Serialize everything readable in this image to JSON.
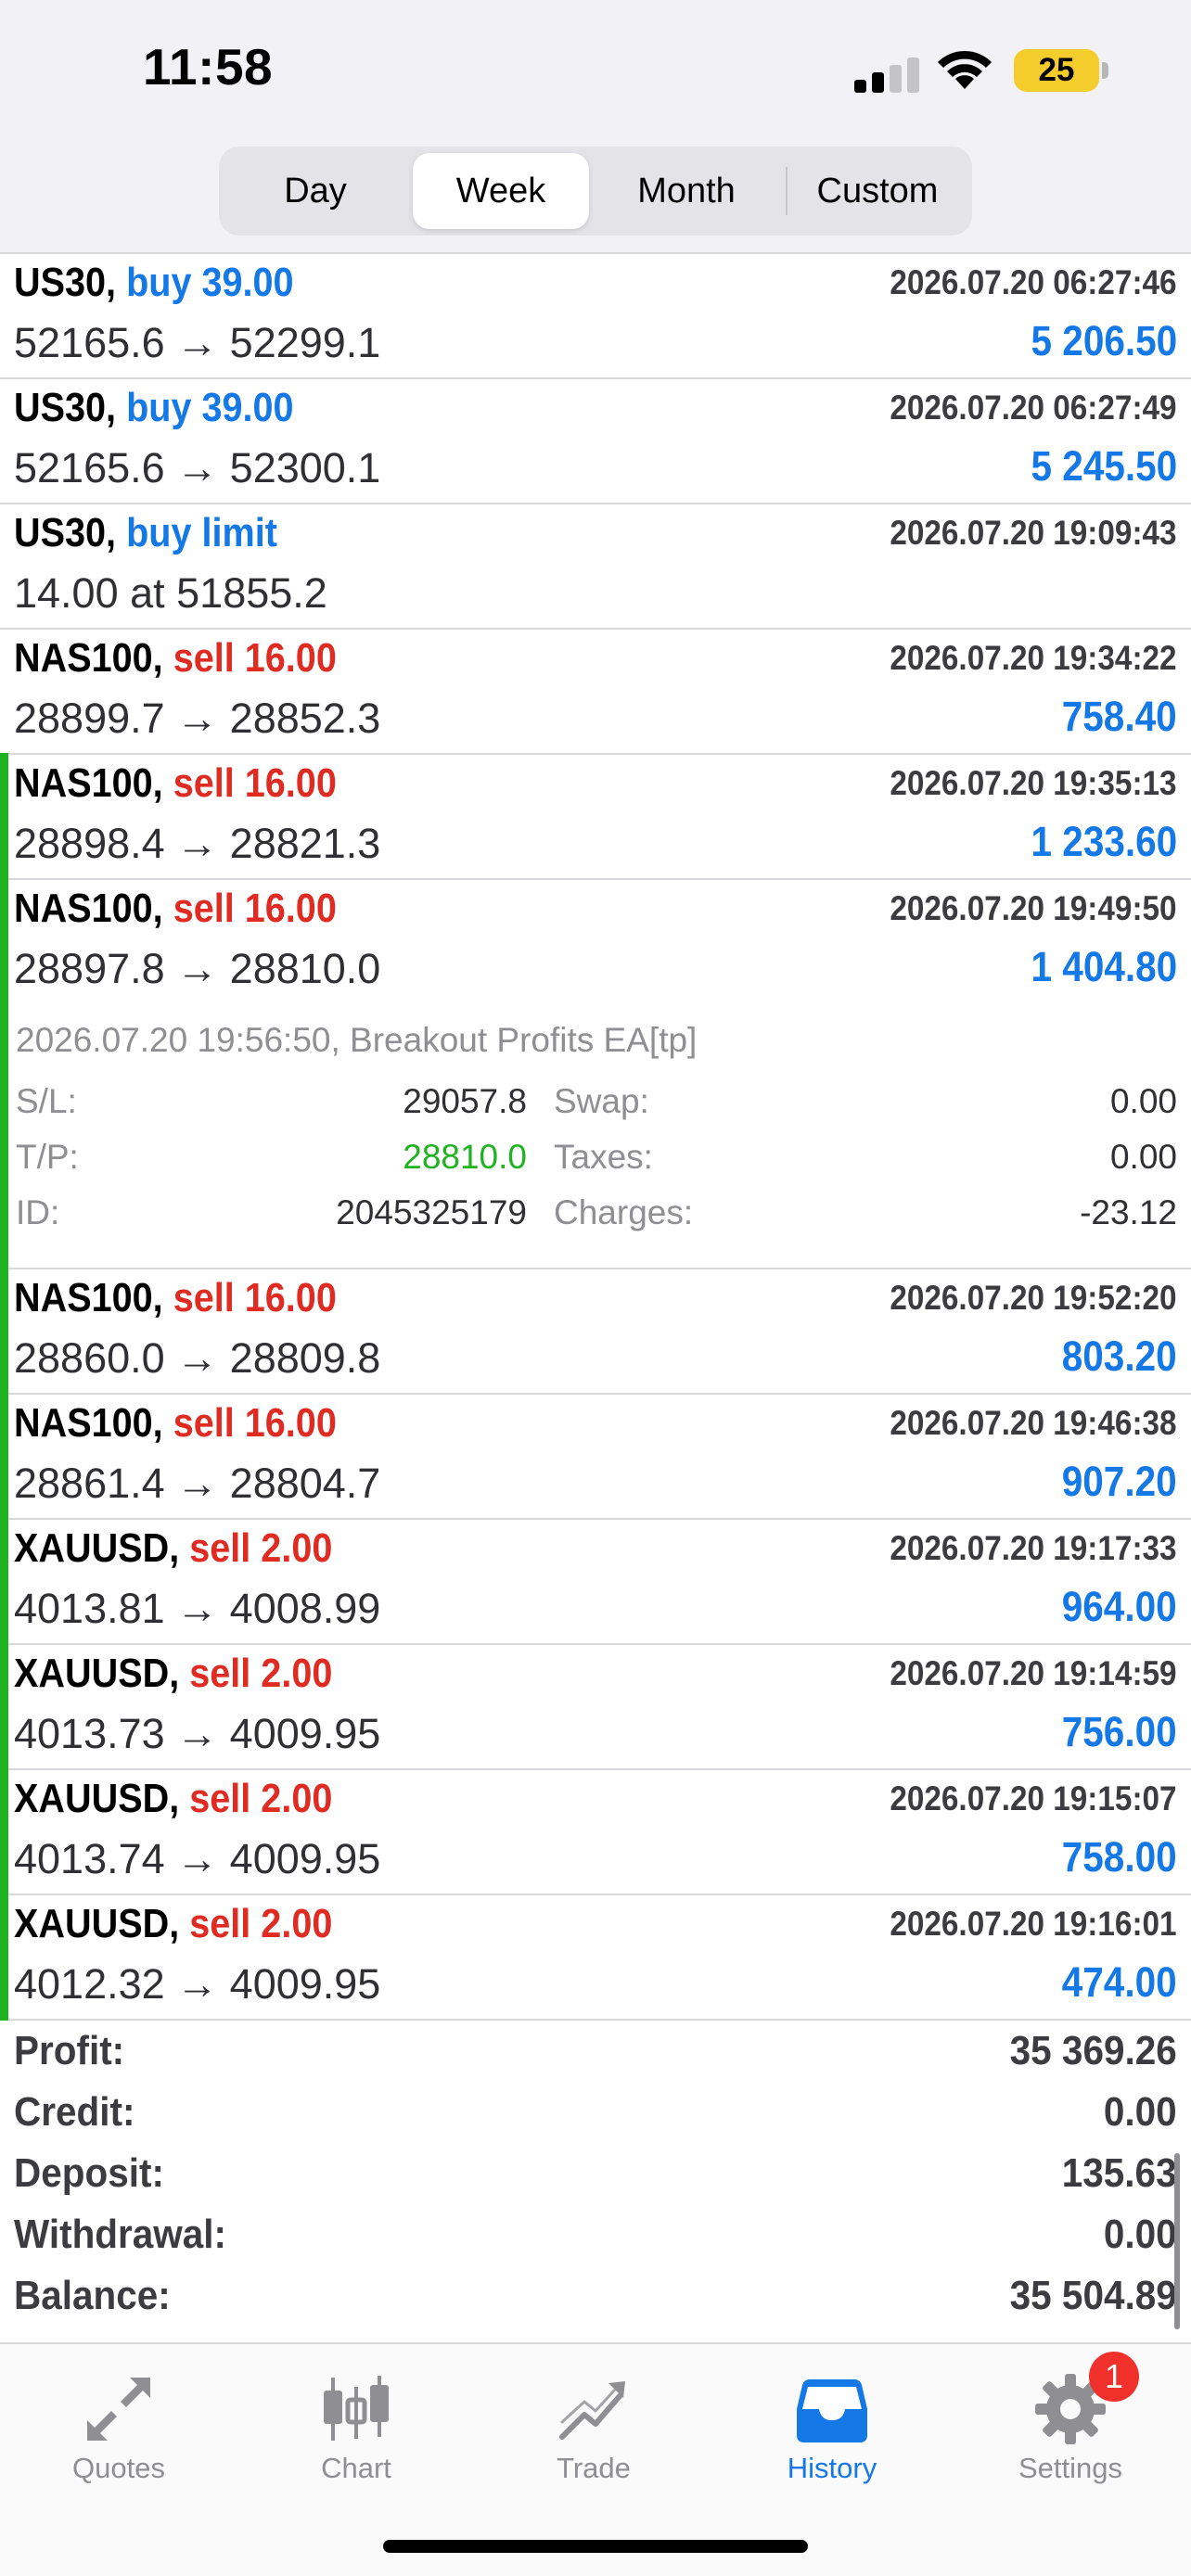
{
  "status_bar": {
    "time": "11:58",
    "battery": "25"
  },
  "period_tabs": [
    {
      "label": "Day",
      "active": false
    },
    {
      "label": "Week",
      "active": true
    },
    {
      "label": "Month",
      "active": false
    },
    {
      "label": "Custom",
      "active": false
    }
  ],
  "deals": [
    {
      "symbol": "US30,",
      "action": "buy 39.00",
      "action_color": "blue",
      "datetime": "2026.07.20 06:27:46",
      "prices": "52165.6 → 52299.1",
      "profit": "5 206.50"
    },
    {
      "symbol": "US30,",
      "action": "buy 39.00",
      "action_color": "blue",
      "datetime": "2026.07.20 06:27:49",
      "prices": "52165.6 → 52300.1",
      "profit": "5 245.50"
    },
    {
      "symbol": "US30,",
      "action": "buy limit",
      "action_color": "blue",
      "datetime": "2026.07.20 19:09:43",
      "prices": "14.00 at 51855.2",
      "profit": ""
    },
    {
      "symbol": "NAS100,",
      "action": "sell 16.00",
      "action_color": "red",
      "datetime": "2026.07.20 19:34:22",
      "prices": "28899.7 → 28852.3",
      "profit": "758.40"
    },
    {
      "symbol": "NAS100,",
      "action": "sell 16.00",
      "action_color": "red",
      "datetime": "2026.07.20 19:35:13",
      "prices": "28898.4 → 28821.3",
      "profit": "1 233.60"
    },
    {
      "symbol": "NAS100,",
      "action": "sell 16.00",
      "action_color": "red",
      "datetime": "2026.07.20 19:49:50",
      "prices": "28897.8 → 28810.0",
      "profit": "1 404.80",
      "details": {
        "comment": "2026.07.20 19:56:50, Breakout Profits EA[tp]",
        "sl_label": "S/L:",
        "sl_value": "29057.8",
        "tp_label": "T/P:",
        "tp_value": "28810.0",
        "id_label": "ID:",
        "id_value": "2045325179",
        "swap_label": "Swap:",
        "swap_value": "0.00",
        "taxes_label": "Taxes:",
        "taxes_value": "0.00",
        "charges_label": "Charges:",
        "charges_value": "-23.12"
      }
    },
    {
      "symbol": "NAS100,",
      "action": "sell 16.00",
      "action_color": "red",
      "datetime": "2026.07.20 19:52:20",
      "prices": "28860.0 → 28809.8",
      "profit": "803.20"
    },
    {
      "symbol": "NAS100,",
      "action": "sell 16.00",
      "action_color": "red",
      "datetime": "2026.07.20 19:46:38",
      "prices": "28861.4 → 28804.7",
      "profit": "907.20"
    },
    {
      "symbol": "XAUUSD,",
      "action": "sell 2.00",
      "action_color": "red",
      "datetime": "2026.07.20 19:17:33",
      "prices": "4013.81 → 4008.99",
      "profit": "964.00"
    },
    {
      "symbol": "XAUUSD,",
      "action": "sell 2.00",
      "action_color": "red",
      "datetime": "2026.07.20 19:14:59",
      "prices": "4013.73 → 4009.95",
      "profit": "756.00"
    },
    {
      "symbol": "XAUUSD,",
      "action": "sell 2.00",
      "action_color": "red",
      "datetime": "2026.07.20 19:15:07",
      "prices": "4013.74 → 4009.95",
      "profit": "758.00"
    },
    {
      "symbol": "XAUUSD,",
      "action": "sell 2.00",
      "action_color": "red",
      "datetime": "2026.07.20 19:16:01",
      "prices": "4012.32 → 4009.95",
      "profit": "474.00"
    }
  ],
  "summary": [
    {
      "label": "Profit:",
      "value": "35 369.26"
    },
    {
      "label": "Credit:",
      "value": "0.00"
    },
    {
      "label": "Deposit:",
      "value": "135.63"
    },
    {
      "label": "Withdrawal:",
      "value": "0.00"
    },
    {
      "label": "Balance:",
      "value": "35 504.89"
    }
  ],
  "tabbar": {
    "items": [
      {
        "label": "Quotes",
        "icon": "quotes-arrows-icon",
        "active": false
      },
      {
        "label": "Chart",
        "icon": "candlestick-icon",
        "active": false
      },
      {
        "label": "Trade",
        "icon": "trend-line-icon",
        "active": false
      },
      {
        "label": "History",
        "icon": "inbox-tray-icon",
        "active": true
      },
      {
        "label": "Settings",
        "icon": "gear-icon",
        "active": false
      }
    ],
    "settings_badge": "1"
  },
  "colors": {
    "accent_blue": "#1478e6",
    "sell_red": "#df2b22",
    "profit_green": "#1fb31f",
    "badge_red": "#f0302a"
  }
}
